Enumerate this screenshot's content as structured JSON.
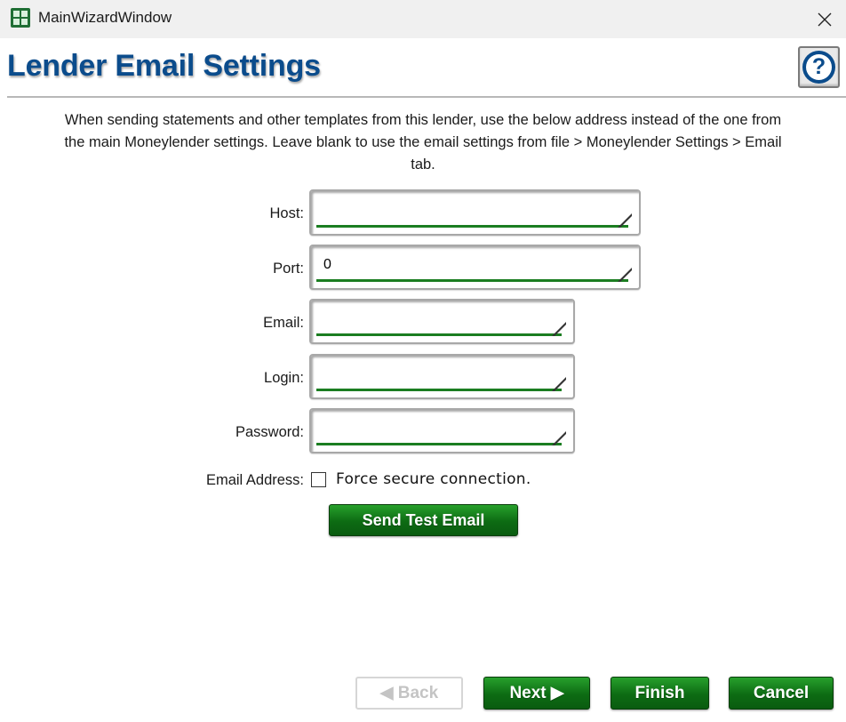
{
  "window": {
    "title": "MainWizardWindow"
  },
  "header": {
    "title": "Lender Email Settings",
    "help_label": "?"
  },
  "description": "When sending statements and other templates from this lender, use the below address instead of the one from the main Moneylender settings. Leave blank to use the email settings from file > Moneylender Settings > Email tab.",
  "form": {
    "host": {
      "label": "Host:",
      "value": ""
    },
    "port": {
      "label": "Port:",
      "value": "0"
    },
    "email": {
      "label": "Email:",
      "value": ""
    },
    "login": {
      "label": "Login:",
      "value": ""
    },
    "password": {
      "label": "Password:",
      "value": ""
    },
    "email_address_label": "Email Address:",
    "secure_checkbox": {
      "label": "Force secure connection.",
      "checked": false
    },
    "send_test_label": "Send Test Email"
  },
  "footer": {
    "back_label": "◀ Back",
    "next_label": "Next ▶",
    "finish_label": "Finish",
    "cancel_label": "Cancel"
  },
  "colors": {
    "title_blue": "#0b4c8c",
    "button_green": "#0d6b13",
    "field_underline": "#1b7d21"
  },
  "icons": [
    "spreadsheet-app-icon",
    "close-icon",
    "help-icon",
    "resize-grip-icon",
    "checkbox-icon"
  ]
}
